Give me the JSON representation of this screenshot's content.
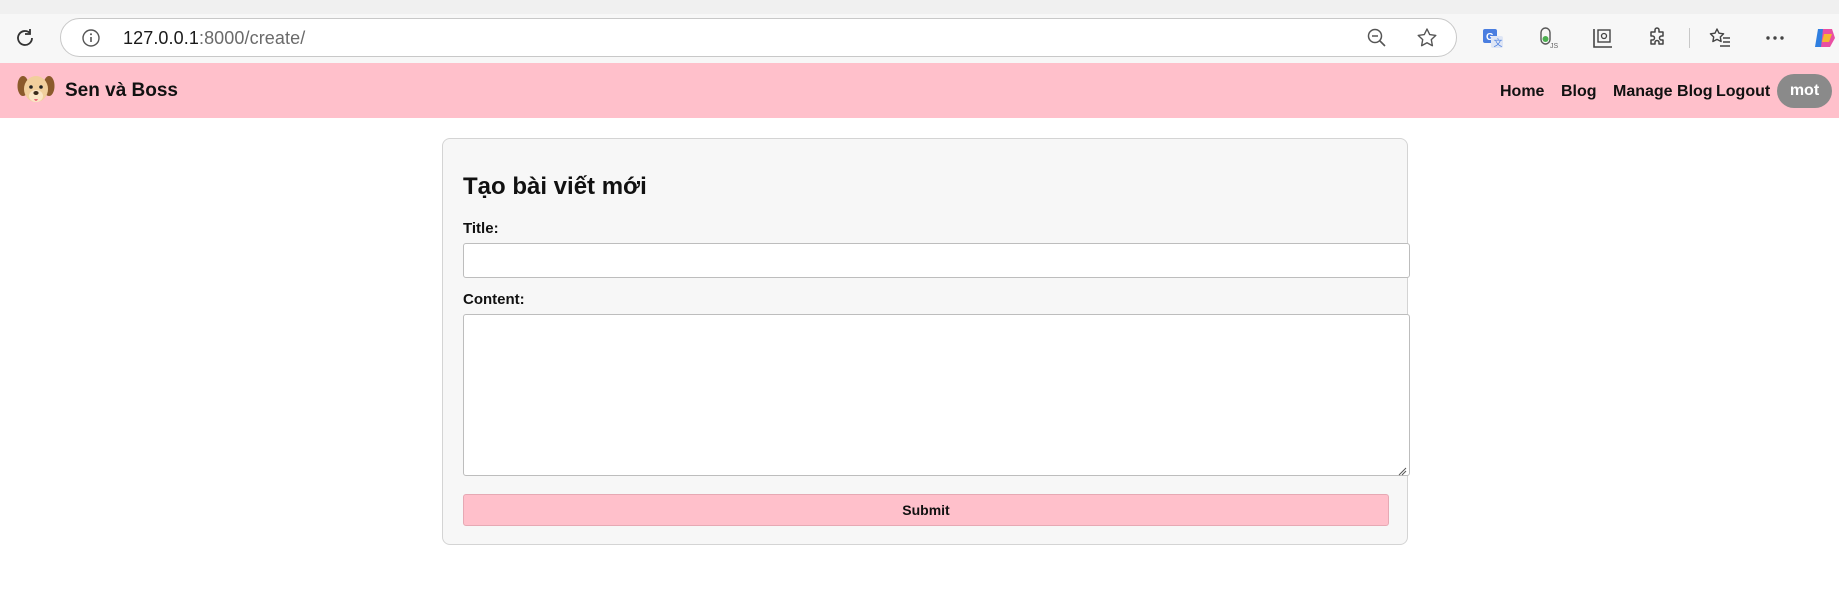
{
  "browser": {
    "url_host": "127.0.0.1",
    "url_path": ":8000/create/",
    "icons": [
      "reload-icon",
      "info-icon",
      "zoom-out-icon",
      "favorite-star-icon",
      "translate-extension-icon",
      "js-toggle-extension-icon",
      "screenshot-extension-icon",
      "extensions-puzzle-icon",
      "favorites-icon",
      "more-menu-icon",
      "copilot-icon"
    ]
  },
  "site": {
    "brand": "Sen và Boss",
    "nav": {
      "home": "Home",
      "blog": "Blog",
      "manage_blog": "Manage Blog",
      "logout": "Logout"
    },
    "user": "mot",
    "colors": {
      "navbar": "#ffc0cb",
      "badge": "#8a8a8a"
    }
  },
  "form": {
    "heading": "Tạo bài viết mới",
    "title_label": "Title:",
    "title_value": "",
    "content_label": "Content:",
    "content_value": "",
    "submit_label": "Submit"
  }
}
